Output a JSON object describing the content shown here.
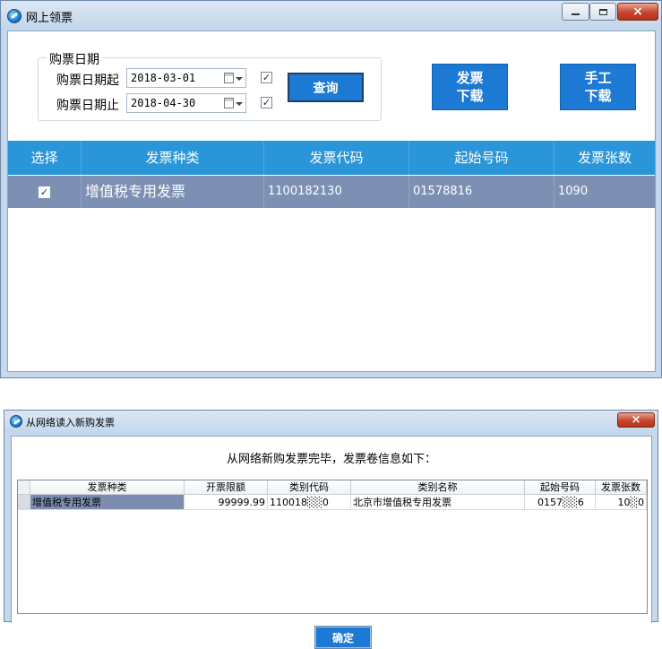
{
  "window1": {
    "title": "网上领票",
    "date_group": {
      "legend": "购票日期",
      "start_label": "购票日期起",
      "start_value": "2018-03-01",
      "end_label": "购票日期止",
      "end_value": "2018-04-30",
      "check_mark": "✓"
    },
    "query_button": "查询",
    "invoice_download_button": {
      "line1": "发票",
      "line2": "下载"
    },
    "manual_download_button": {
      "line1": "手工",
      "line2": "下载"
    },
    "table": {
      "columns": [
        "选择",
        "发票种类",
        "发票代码",
        "起始号码",
        "发票张数"
      ],
      "rows": [
        {
          "selected_mark": "✓",
          "type": "增值税专用发票",
          "code": "1100182130",
          "start_no": "01578816",
          "count": "1090"
        }
      ]
    }
  },
  "window2": {
    "title": "从网络读入新购发票",
    "close_glyph": "×",
    "message": "从网络新购发票完毕，发票卷信息如下：",
    "table": {
      "columns": [
        "发票种类",
        "开票限额",
        "类别代码",
        "类别名称",
        "起始号码",
        "发票张数"
      ],
      "rows": [
        {
          "type": "增值税专用发票",
          "limit": "99999.99",
          "code": "110018░░0",
          "name": "北京市增值税专用发票",
          "start_no": "0157░░6",
          "count": "10░0"
        }
      ]
    },
    "confirm_button": "确定"
  },
  "colors": {
    "accent_blue": "#1c79d4",
    "header_blue": "#2a95d9",
    "selected_row": "#7d90b4",
    "close_red": "#c8452c"
  },
  "icons": [
    "app-icon",
    "minimize-icon",
    "maximize-icon",
    "close-icon",
    "calendar-icon",
    "dropdown-arrow-icon",
    "checkbox-icon"
  ]
}
